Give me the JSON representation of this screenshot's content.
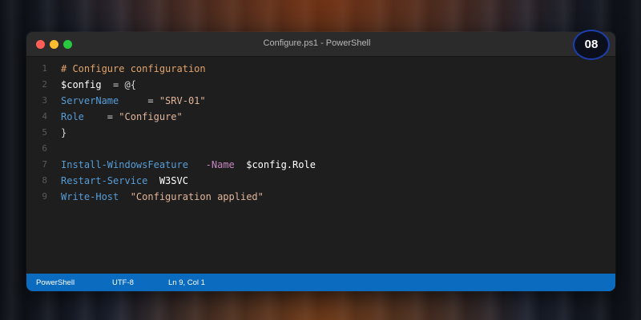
{
  "window": {
    "title": "Configure.ps1 - PowerShell"
  },
  "badge": {
    "number": "08"
  },
  "editor": {
    "lines": [
      {
        "n": "1",
        "tokens": [
          {
            "t": "# Configure configuration",
            "k": "comment"
          }
        ]
      },
      {
        "n": "2",
        "tokens": [
          {
            "t": "$config",
            "k": "var"
          },
          {
            "t": "  = @{",
            "k": "plain"
          }
        ]
      },
      {
        "n": "3",
        "tokens": [
          {
            "t": "ServerName",
            "k": "cmd"
          },
          {
            "t": "     = ",
            "k": "plain"
          },
          {
            "t": "\"SRV-01\"",
            "k": "str"
          }
        ]
      },
      {
        "n": "4",
        "tokens": [
          {
            "t": "Role",
            "k": "cmd"
          },
          {
            "t": "    = ",
            "k": "plain"
          },
          {
            "t": "\"Configure\"",
            "k": "str"
          }
        ]
      },
      {
        "n": "5",
        "tokens": [
          {
            "t": "}",
            "k": "plain"
          }
        ]
      },
      {
        "n": "6",
        "tokens": []
      },
      {
        "n": "7",
        "tokens": [
          {
            "t": "Install-WindowsFeature",
            "k": "cmd"
          },
          {
            "t": "   ",
            "k": "plain"
          },
          {
            "t": "-Name",
            "k": "param"
          },
          {
            "t": "  ",
            "k": "plain"
          },
          {
            "t": "$config.Role",
            "k": "var"
          }
        ]
      },
      {
        "n": "8",
        "tokens": [
          {
            "t": "Restart-Service",
            "k": "cmd"
          },
          {
            "t": "  ",
            "k": "plain"
          },
          {
            "t": "W3SVC",
            "k": "var"
          }
        ]
      },
      {
        "n": "9",
        "tokens": [
          {
            "t": "Write-Host",
            "k": "cmd"
          },
          {
            "t": "  ",
            "k": "plain"
          },
          {
            "t": "\"Configuration applied\"",
            "k": "str"
          }
        ]
      }
    ]
  },
  "statusbar": {
    "language": "PowerShell",
    "encoding": "UTF-8",
    "position": "Ln 9, Col 1"
  },
  "colors": {
    "statusbar_bg": "#0b6bbf",
    "comment": "#e2a36b",
    "command": "#569cd6",
    "string": "#e0b49a",
    "parameter": "#c586c0",
    "variable": "#ffffff"
  }
}
